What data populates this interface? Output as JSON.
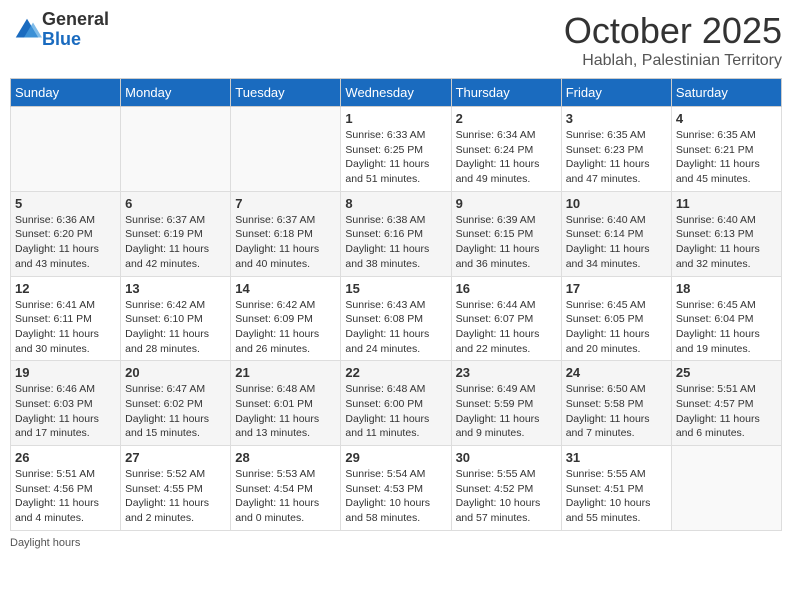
{
  "logo": {
    "general": "General",
    "blue": "Blue"
  },
  "header": {
    "month": "October 2025",
    "location": "Hablah, Palestinian Territory"
  },
  "days_of_week": [
    "Sunday",
    "Monday",
    "Tuesday",
    "Wednesday",
    "Thursday",
    "Friday",
    "Saturday"
  ],
  "weeks": [
    [
      {
        "day": "",
        "info": ""
      },
      {
        "day": "",
        "info": ""
      },
      {
        "day": "",
        "info": ""
      },
      {
        "day": "1",
        "info": "Sunrise: 6:33 AM\nSunset: 6:25 PM\nDaylight: 11 hours\nand 51 minutes."
      },
      {
        "day": "2",
        "info": "Sunrise: 6:34 AM\nSunset: 6:24 PM\nDaylight: 11 hours\nand 49 minutes."
      },
      {
        "day": "3",
        "info": "Sunrise: 6:35 AM\nSunset: 6:23 PM\nDaylight: 11 hours\nand 47 minutes."
      },
      {
        "day": "4",
        "info": "Sunrise: 6:35 AM\nSunset: 6:21 PM\nDaylight: 11 hours\nand 45 minutes."
      }
    ],
    [
      {
        "day": "5",
        "info": "Sunrise: 6:36 AM\nSunset: 6:20 PM\nDaylight: 11 hours\nand 43 minutes."
      },
      {
        "day": "6",
        "info": "Sunrise: 6:37 AM\nSunset: 6:19 PM\nDaylight: 11 hours\nand 42 minutes."
      },
      {
        "day": "7",
        "info": "Sunrise: 6:37 AM\nSunset: 6:18 PM\nDaylight: 11 hours\nand 40 minutes."
      },
      {
        "day": "8",
        "info": "Sunrise: 6:38 AM\nSunset: 6:16 PM\nDaylight: 11 hours\nand 38 minutes."
      },
      {
        "day": "9",
        "info": "Sunrise: 6:39 AM\nSunset: 6:15 PM\nDaylight: 11 hours\nand 36 minutes."
      },
      {
        "day": "10",
        "info": "Sunrise: 6:40 AM\nSunset: 6:14 PM\nDaylight: 11 hours\nand 34 minutes."
      },
      {
        "day": "11",
        "info": "Sunrise: 6:40 AM\nSunset: 6:13 PM\nDaylight: 11 hours\nand 32 minutes."
      }
    ],
    [
      {
        "day": "12",
        "info": "Sunrise: 6:41 AM\nSunset: 6:11 PM\nDaylight: 11 hours\nand 30 minutes."
      },
      {
        "day": "13",
        "info": "Sunrise: 6:42 AM\nSunset: 6:10 PM\nDaylight: 11 hours\nand 28 minutes."
      },
      {
        "day": "14",
        "info": "Sunrise: 6:42 AM\nSunset: 6:09 PM\nDaylight: 11 hours\nand 26 minutes."
      },
      {
        "day": "15",
        "info": "Sunrise: 6:43 AM\nSunset: 6:08 PM\nDaylight: 11 hours\nand 24 minutes."
      },
      {
        "day": "16",
        "info": "Sunrise: 6:44 AM\nSunset: 6:07 PM\nDaylight: 11 hours\nand 22 minutes."
      },
      {
        "day": "17",
        "info": "Sunrise: 6:45 AM\nSunset: 6:05 PM\nDaylight: 11 hours\nand 20 minutes."
      },
      {
        "day": "18",
        "info": "Sunrise: 6:45 AM\nSunset: 6:04 PM\nDaylight: 11 hours\nand 19 minutes."
      }
    ],
    [
      {
        "day": "19",
        "info": "Sunrise: 6:46 AM\nSunset: 6:03 PM\nDaylight: 11 hours\nand 17 minutes."
      },
      {
        "day": "20",
        "info": "Sunrise: 6:47 AM\nSunset: 6:02 PM\nDaylight: 11 hours\nand 15 minutes."
      },
      {
        "day": "21",
        "info": "Sunrise: 6:48 AM\nSunset: 6:01 PM\nDaylight: 11 hours\nand 13 minutes."
      },
      {
        "day": "22",
        "info": "Sunrise: 6:48 AM\nSunset: 6:00 PM\nDaylight: 11 hours\nand 11 minutes."
      },
      {
        "day": "23",
        "info": "Sunrise: 6:49 AM\nSunset: 5:59 PM\nDaylight: 11 hours\nand 9 minutes."
      },
      {
        "day": "24",
        "info": "Sunrise: 6:50 AM\nSunset: 5:58 PM\nDaylight: 11 hours\nand 7 minutes."
      },
      {
        "day": "25",
        "info": "Sunrise: 5:51 AM\nSunset: 4:57 PM\nDaylight: 11 hours\nand 6 minutes."
      }
    ],
    [
      {
        "day": "26",
        "info": "Sunrise: 5:51 AM\nSunset: 4:56 PM\nDaylight: 11 hours\nand 4 minutes."
      },
      {
        "day": "27",
        "info": "Sunrise: 5:52 AM\nSunset: 4:55 PM\nDaylight: 11 hours\nand 2 minutes."
      },
      {
        "day": "28",
        "info": "Sunrise: 5:53 AM\nSunset: 4:54 PM\nDaylight: 11 hours\nand 0 minutes."
      },
      {
        "day": "29",
        "info": "Sunrise: 5:54 AM\nSunset: 4:53 PM\nDaylight: 10 hours\nand 58 minutes."
      },
      {
        "day": "30",
        "info": "Sunrise: 5:55 AM\nSunset: 4:52 PM\nDaylight: 10 hours\nand 57 minutes."
      },
      {
        "day": "31",
        "info": "Sunrise: 5:55 AM\nSunset: 4:51 PM\nDaylight: 10 hours\nand 55 minutes."
      },
      {
        "day": "",
        "info": ""
      }
    ]
  ],
  "footer": {
    "note": "Daylight hours"
  }
}
